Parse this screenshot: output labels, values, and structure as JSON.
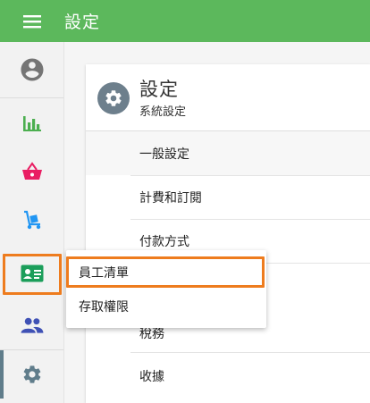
{
  "appbar": {
    "title": "設定",
    "menu_icon": "hamburger-menu-icon",
    "bg_color": "#5cb85c"
  },
  "rail": {
    "items": [
      {
        "icon": "account-circle-icon"
      },
      {
        "icon": "bar-chart-icon"
      },
      {
        "icon": "shopping-basket-icon"
      },
      {
        "icon": "hand-truck-icon"
      },
      {
        "icon": "employee-badge-icon"
      },
      {
        "icon": "people-icon"
      },
      {
        "icon": "gear-icon"
      }
    ],
    "active_icon": "gear-icon"
  },
  "card": {
    "title": "設定",
    "subtitle": "系統設定",
    "header_icon": "gear-icon",
    "items": [
      {
        "label": "一般設定"
      },
      {
        "label": "計費和訂閱"
      },
      {
        "label": "付款方式"
      },
      {
        "label": "稅務"
      },
      {
        "label": "收據"
      }
    ]
  },
  "popup": {
    "items": [
      {
        "label": "員工清單"
      },
      {
        "label": "存取權限"
      }
    ]
  },
  "colors": {
    "accent_green": "#5cb85c",
    "highlight_orange": "#ee7c1e",
    "chart_green": "#4caf50",
    "basket_pink": "#e91e63",
    "truck_blue": "#2196f3",
    "badge_green": "#1b9e5a",
    "people_indigo": "#3f51b5",
    "gear_gray": "#607d8b"
  }
}
